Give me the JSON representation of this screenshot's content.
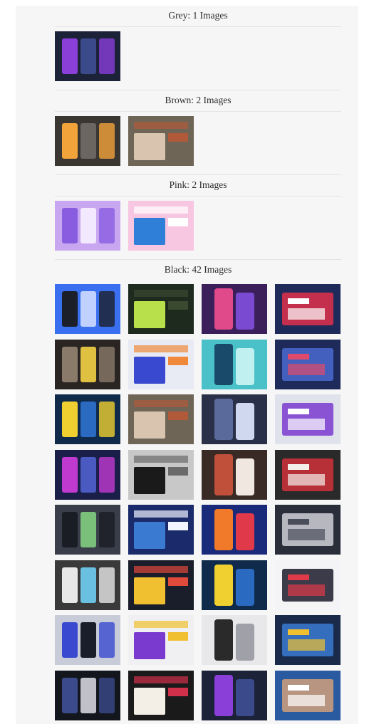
{
  "sections": [
    {
      "title": "Grey: 1 Images"
    },
    {
      "title": "Brown: 2 Images"
    },
    {
      "title": "Pink: 2 Images"
    },
    {
      "title": "Black: 42 Images"
    }
  ],
  "galleries": {
    "grey": [
      {
        "name": "dark-dashboard-thumb",
        "bg": "#1c2238",
        "accent": "#8a3fd9",
        "accent2": "#3a4a8a"
      }
    ],
    "brown": [
      {
        "name": "dark-signup-thumb",
        "bg": "#3a3733",
        "accent": "#f2a33a",
        "accent2": "#6b6660"
      },
      {
        "name": "portrait-landing-thumb",
        "bg": "#6e6556",
        "accent": "#d9c4b0",
        "accent2": "#b05a3a"
      }
    ],
    "pink": [
      {
        "name": "purple-illustration-thumb",
        "bg": "#c9a7f0",
        "accent": "#8a5ce0",
        "accent2": "#f3e9ff"
      },
      {
        "name": "balloon-festival-thumb",
        "bg": "#f7c6e0",
        "accent": "#2f7fd8",
        "accent2": "#ffffff"
      }
    ],
    "black": [
      {
        "name": "blue-app-screens-thumb",
        "bg": "#3a6ff0",
        "accent": "#1b1f2a",
        "accent2": "#c0d0ff"
      },
      {
        "name": "green-text-poster-thumb",
        "bg": "#1f2a1e",
        "accent": "#b7e04a",
        "accent2": "#3a4a30"
      },
      {
        "name": "gradient-phones-thumb",
        "bg": "#3a1f5a",
        "accent": "#e04a8a",
        "accent2": "#7a4ad0"
      },
      {
        "name": "login-form-thumb",
        "bg": "#1e2a5a",
        "accent": "#ffffff",
        "accent2": "#e0304a"
      },
      {
        "name": "mountain-hero-thumb",
        "bg": "#2a2522",
        "accent": "#8a7a6a",
        "accent2": "#e0c040"
      },
      {
        "name": "colorful-ui-kit-thumb",
        "bg": "#e8eaf4",
        "accent": "#3a4ad0",
        "accent2": "#f08a3a"
      },
      {
        "name": "teal-3d-scene-thumb",
        "bg": "#4ac0c8",
        "accent": "#1a4a6a",
        "accent2": "#c0f0f0"
      },
      {
        "name": "navy-dashboard-widgets-thumb",
        "bg": "#1e2a5a",
        "accent": "#e04a6a",
        "accent2": "#4a6ad0"
      },
      {
        "name": "blue-yellow-phone-thumb",
        "bg": "#0f2a4a",
        "accent": "#f0d030",
        "accent2": "#2a6ac0"
      },
      {
        "name": "portrait-landing-2-thumb",
        "bg": "#6e6556",
        "accent": "#d9c4b0",
        "accent2": "#b05a3a"
      },
      {
        "name": "dark-admin-panel-thumb",
        "bg": "#2a3048",
        "accent": "#5a6a9a",
        "accent2": "#d0d8f0"
      },
      {
        "name": "white-phones-thumb",
        "bg": "#dfe2ea",
        "accent": "#ffffff",
        "accent2": "#7a3ad0"
      },
      {
        "name": "purple-analytics-thumb",
        "bg": "#1a1f4a",
        "accent": "#c03ad0",
        "accent2": "#4a5ac0"
      },
      {
        "name": "dark-music-screens-thumb",
        "bg": "#c8c8c8",
        "accent": "#1a1a1a",
        "accent2": "#6a6a6a"
      },
      {
        "name": "jobhunt-landing-thumb",
        "bg": "#3a2a26",
        "accent": "#c0503a",
        "accent2": "#f0e8e0"
      },
      {
        "name": "spring-collection-thumb",
        "bg": "#2a2a2a",
        "accent": "#f4f0ea",
        "accent2": "#d0303a"
      },
      {
        "name": "dark-mobile-screens-thumb",
        "bg": "#3a3d4a",
        "accent": "#1a1d24",
        "accent2": "#7ac07a"
      },
      {
        "name": "blue-data-dashboard-thumb",
        "bg": "#1a2a6a",
        "accent": "#3a7ad0",
        "accent2": "#f0f4ff"
      },
      {
        "name": "orange-music-app-thumb",
        "bg": "#1a2a7a",
        "accent": "#f07a2a",
        "accent2": "#e03a4a"
      },
      {
        "name": "dark-list-phone-thumb",
        "bg": "#2a2d3a",
        "accent": "#4a4d5a",
        "accent2": "#d0d0d8"
      },
      {
        "name": "the-eternal-poster-thumb",
        "bg": "#3a3a3a",
        "accent": "#e8e8e8",
        "accent2": "#6ac0e0"
      },
      {
        "name": "yellow-card-phone-thumb",
        "bg": "#1a1d2a",
        "accent": "#f0c030",
        "accent2": "#e04a3a"
      },
      {
        "name": "blue-yellow-phone-2-thumb",
        "bg": "#0f2a4a",
        "accent": "#f0d030",
        "accent2": "#2a6ac0"
      },
      {
        "name": "travel-phones-thumb",
        "bg": "#f4f4f6",
        "accent": "#e03a4a",
        "accent2": "#1a1a2a"
      },
      {
        "name": "grey-mobile-grid-thumb",
        "bg": "#c8ccd8",
        "accent": "#3a4ad0",
        "accent2": "#1a1d2a"
      },
      {
        "name": "plant-shop-thumb",
        "bg": "#f0f0f2",
        "accent": "#7a3ad0",
        "accent2": "#f0c030"
      },
      {
        "name": "wireframe-screens-thumb",
        "bg": "#e8e8ea",
        "accent": "#2a2a2a",
        "accent2": "#a0a0a8"
      },
      {
        "name": "dark-payment-phone-thumb",
        "bg": "#1a2a4a",
        "accent": "#f0c030",
        "accent2": "#3a7ad0"
      },
      {
        "name": "dark-gallery-grid-thumb",
        "bg": "#14161e",
        "accent": "#3a4a8a",
        "accent2": "#c0c0c8"
      },
      {
        "name": "signature-landing-thumb",
        "bg": "#1a1a1a",
        "accent": "#f4efe6",
        "accent2": "#d0304a"
      },
      {
        "name": "dark-dashboard-2-thumb",
        "bg": "#1c2238",
        "accent": "#8a3fd9",
        "accent2": "#3a4a8a"
      },
      {
        "name": "hand-holding-phone-thumb",
        "bg": "#2a5aa0",
        "accent": "#ffffff",
        "accent2": "#d0a07a"
      }
    ]
  }
}
